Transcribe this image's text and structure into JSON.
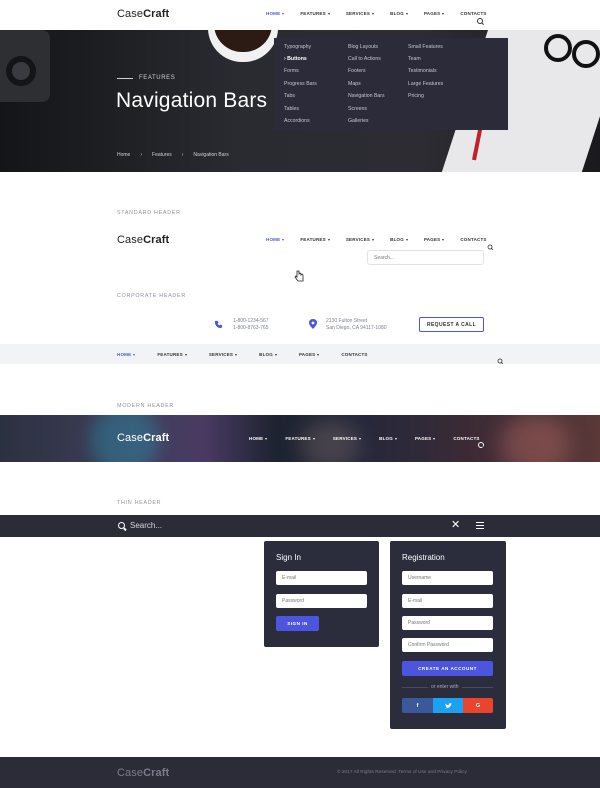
{
  "brand": {
    "light": "Case",
    "bold": "Craft"
  },
  "nav": {
    "items": [
      "HOME",
      "FEATURES",
      "SERVICES",
      "BLOG",
      "PAGES",
      "CONTACTS"
    ]
  },
  "hero": {
    "eyebrow": "FEATURES",
    "title": "Navigation Bars",
    "breadcrumb": [
      "Home",
      "Features",
      "Navigation Bars"
    ]
  },
  "dropdown": {
    "col1": [
      "Typography",
      "Buttons",
      "Forms",
      "Progress Bars",
      "Tabs",
      "Tables",
      "Accordions"
    ],
    "col2": [
      "Blog Layouts",
      "Call to Actions",
      "Footers",
      "Maps",
      "Navigation Bars",
      "Screens",
      "Galleries"
    ],
    "col3": [
      "Small Features",
      "Team",
      "Testimonials",
      "Large Features",
      "Pricing"
    ],
    "active": "Buttons"
  },
  "standard": {
    "label": "STANDARD HEADER",
    "search_placeholder": "Search..."
  },
  "corporate": {
    "label": "CORPORATE HEADER",
    "phone1": "1-800-1234-567",
    "phone2": "1-800-8763-765",
    "address1": "2130 Fulton Street",
    "address2": "San Diego, CA 94117-1080",
    "cta": "REQUEST A CALL"
  },
  "modern": {
    "label": "MODERN HEADER"
  },
  "thin": {
    "label": "THIN HEADER",
    "search_placeholder": "Search..."
  },
  "signin": {
    "title": "Sign In",
    "email": "E-mail",
    "password": "Password",
    "button": "SIGN IN"
  },
  "registration": {
    "title": "Registration",
    "username": "Username",
    "email": "E-mail",
    "password": "Password",
    "confirm": "Confirm Password",
    "button": "CREATE AN ACCOUNT",
    "or": "or enter with",
    "google": "G"
  },
  "footer": {
    "copyright": "© 2017 All Rights Reserved. Terms of Use and Privacy Policy"
  },
  "colors": {
    "accent": "#4b55e0",
    "dark": "#2b2c38",
    "facebook": "#3b5998",
    "twitter": "#1da1f2",
    "google": "#e8452c"
  }
}
